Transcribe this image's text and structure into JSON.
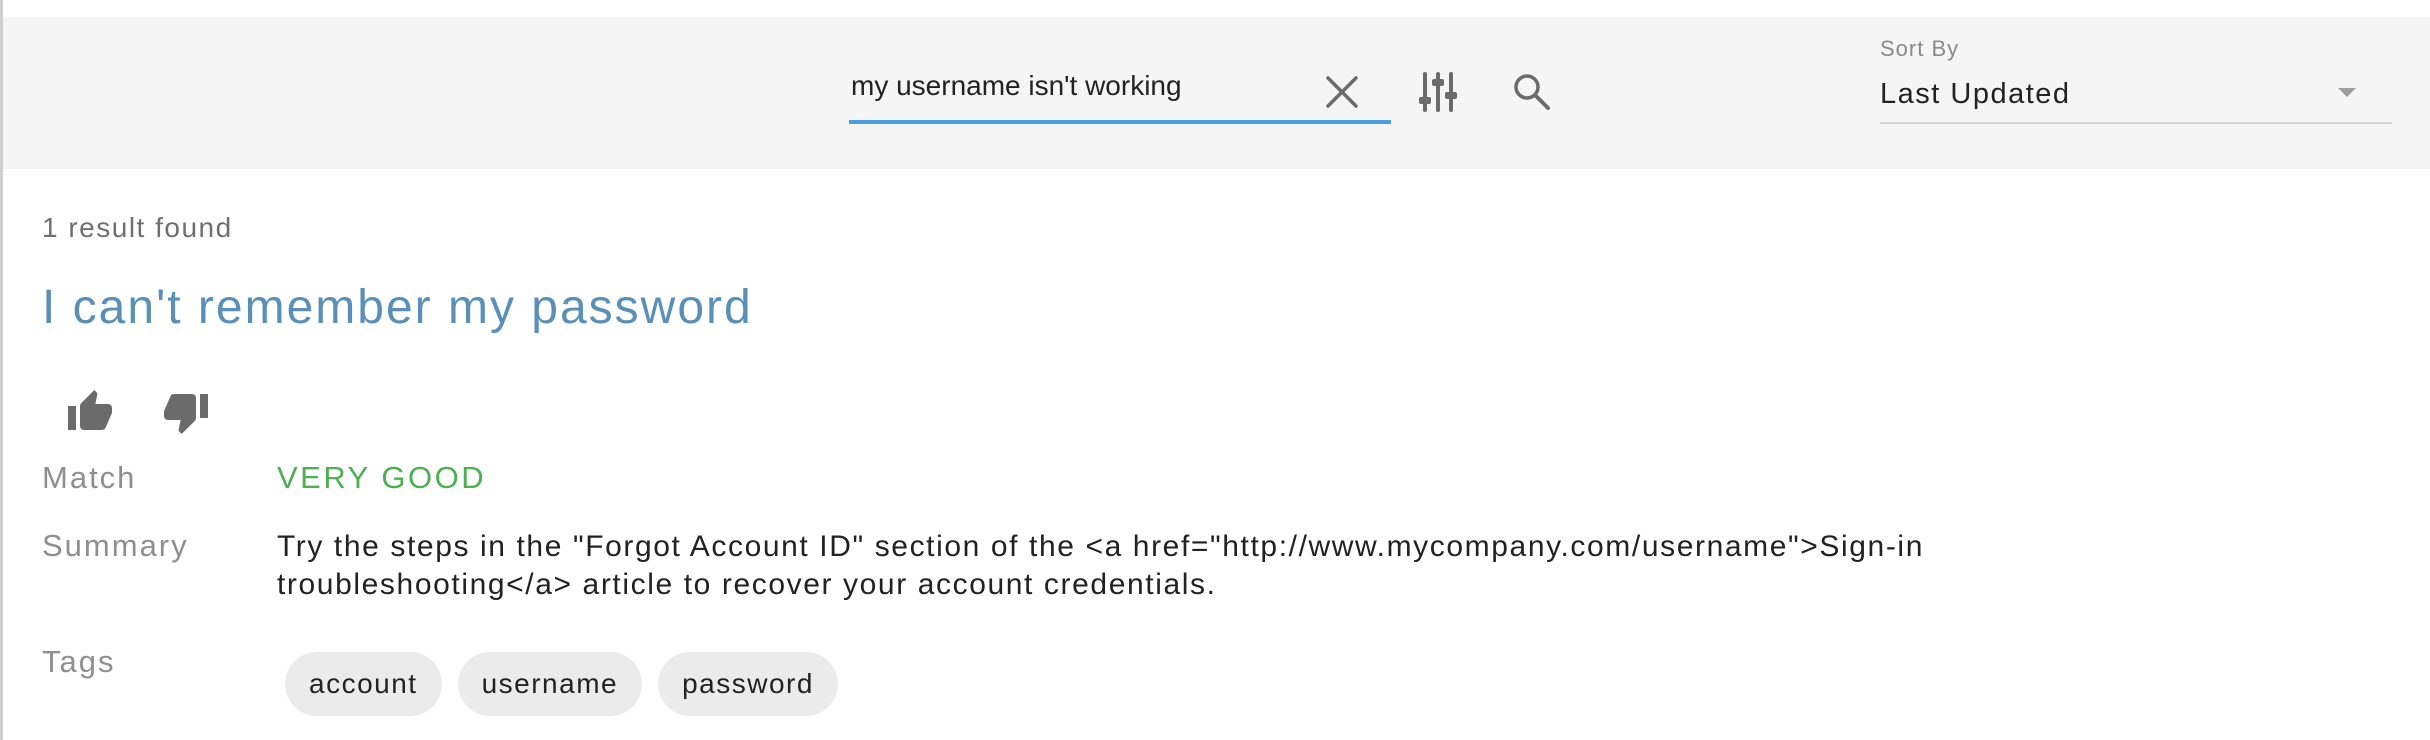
{
  "search": {
    "value": "my username isn't working",
    "clear_icon": "close-icon",
    "filter_icon": "tune-sliders-icon",
    "search_icon": "search-icon",
    "accent_color": "#4a9ee0"
  },
  "sort": {
    "label": "Sort By",
    "selected": "Last Updated",
    "caret_icon": "caret-down-icon"
  },
  "results": {
    "count_text": "1 result found",
    "items": [
      {
        "title": "I can't remember my password",
        "title_color": "#5a8fba",
        "thumbs_up_icon": "thumb-up-icon",
        "thumbs_down_icon": "thumb-down-icon",
        "match_label": "Match",
        "match_value": "VERY GOOD",
        "match_color": "#4caf50",
        "summary_label": "Summary",
        "summary_value": "Try the steps in the \"Forgot Account ID\" section of the <a href=\"http://www.mycompany.com/username\">Sign-in\ntroubleshooting</a> article to recover your account credentials.",
        "tags_label": "Tags",
        "tags": [
          "account",
          "username",
          "password"
        ]
      }
    ]
  }
}
